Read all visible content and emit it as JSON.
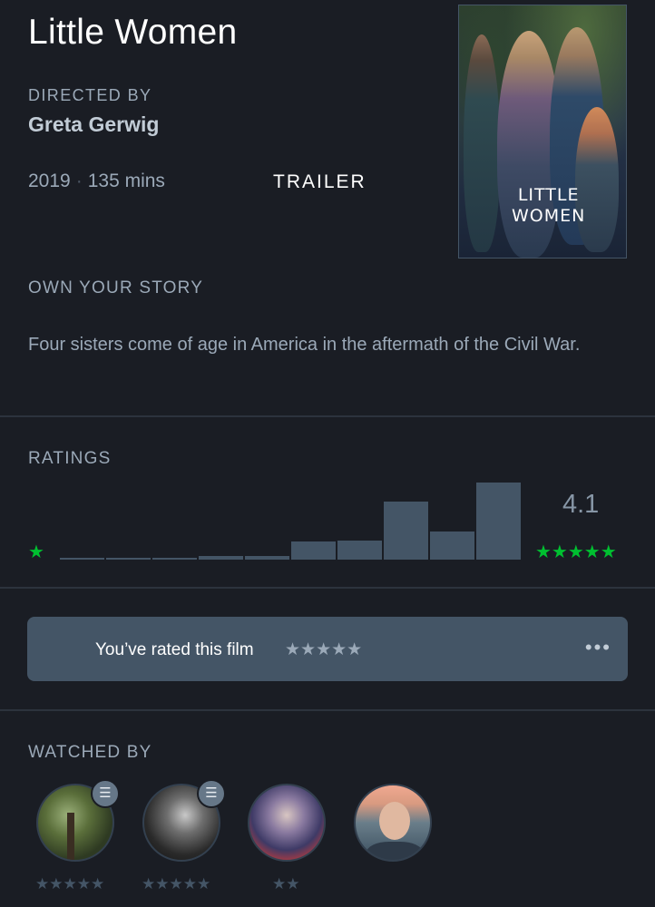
{
  "film": {
    "title": "Little Women",
    "directed_by_label": "DIRECTED BY",
    "director": "Greta Gerwig",
    "year": "2019",
    "separator": "·",
    "runtime": "135 mins",
    "trailer_label": "TRAILER",
    "poster_text_line1": "LITTLE",
    "poster_text_line2": "WOMEN",
    "tagline": "OWN YOUR STORY",
    "description": "Four sisters come of age in America in the aftermath of the Civil War."
  },
  "ratings": {
    "label": "RATINGS",
    "average": "4.1",
    "low_star": "★",
    "high_stars": "★★★★★",
    "histogram_fractions": [
      0.01,
      0.01,
      0.01,
      0.05,
      0.05,
      0.24,
      0.25,
      0.75,
      0.37,
      1.0
    ]
  },
  "user_rating": {
    "text": "You’ve rated this film",
    "stars": "★★★★★",
    "more": "•••"
  },
  "watched_by": {
    "label": "WATCHED BY",
    "users": [
      {
        "stars": "★★★★★",
        "has_review": true,
        "review_icon": "☰"
      },
      {
        "stars": "★★★★★",
        "has_review": true,
        "review_icon": "☰"
      },
      {
        "stars": "★★",
        "has_review": false
      },
      {
        "stars": "",
        "has_review": false
      }
    ]
  },
  "colors": {
    "background": "#1a1d24",
    "accent_green": "#00c030",
    "bar": "#445566",
    "text_muted": "#9ba9b8"
  }
}
